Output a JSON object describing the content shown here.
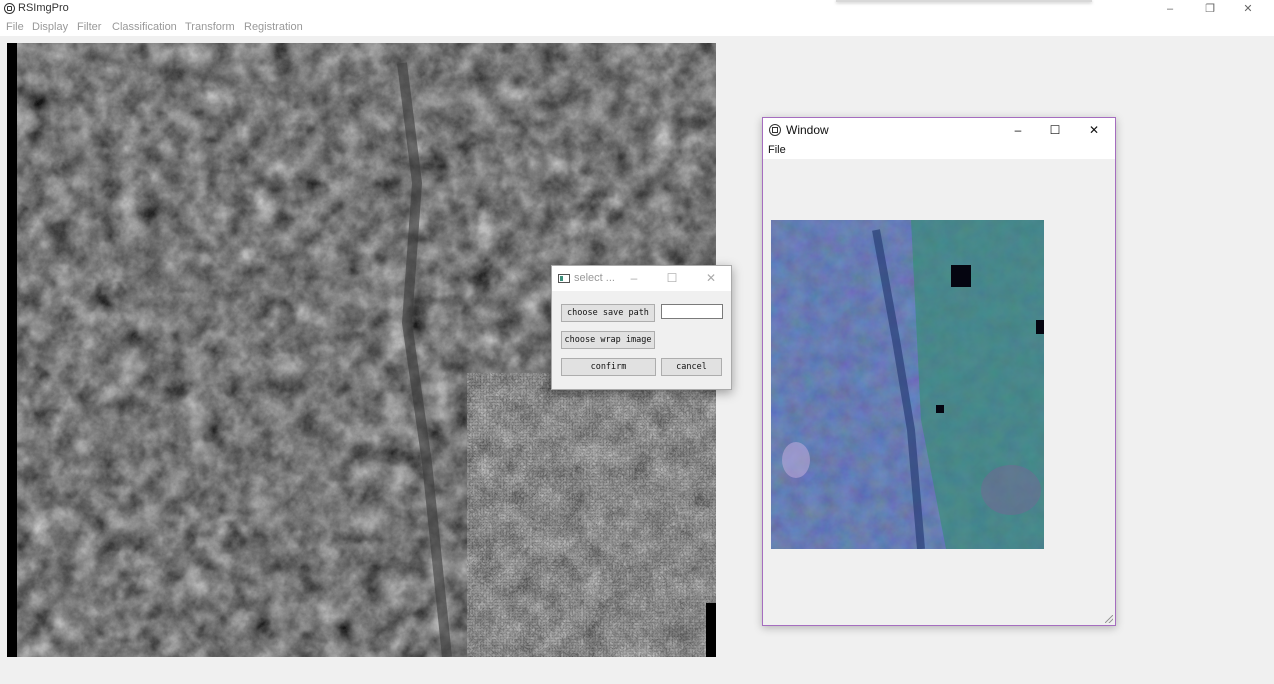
{
  "app": {
    "title": "RSImgPro",
    "controls": {
      "minimize": "–",
      "restore": "❐",
      "close": "✕"
    }
  },
  "menubar": {
    "items": [
      "File",
      "Display",
      "Filter",
      "Classification",
      "Transform",
      "Registration"
    ]
  },
  "window": {
    "title": "Window",
    "menu": [
      "File"
    ],
    "controls": {
      "minimize": "–",
      "maximize": "☐",
      "close": "✕"
    }
  },
  "dialog": {
    "title": "select ...",
    "controls": {
      "minimize": "–",
      "maximize": "☐",
      "close": "✕"
    },
    "choose_save_path_label": "choose save path",
    "save_path_value": "",
    "choose_wrap_image_label": "choose wrap image",
    "confirm_label": "confirm",
    "cancel_label": "cancel"
  },
  "colors": {
    "window_border": "#a56dbf",
    "false_color_blue": "#3c4f90",
    "false_color_green": "#2f8f6a",
    "grayscale_base": "#0a0a0a"
  }
}
